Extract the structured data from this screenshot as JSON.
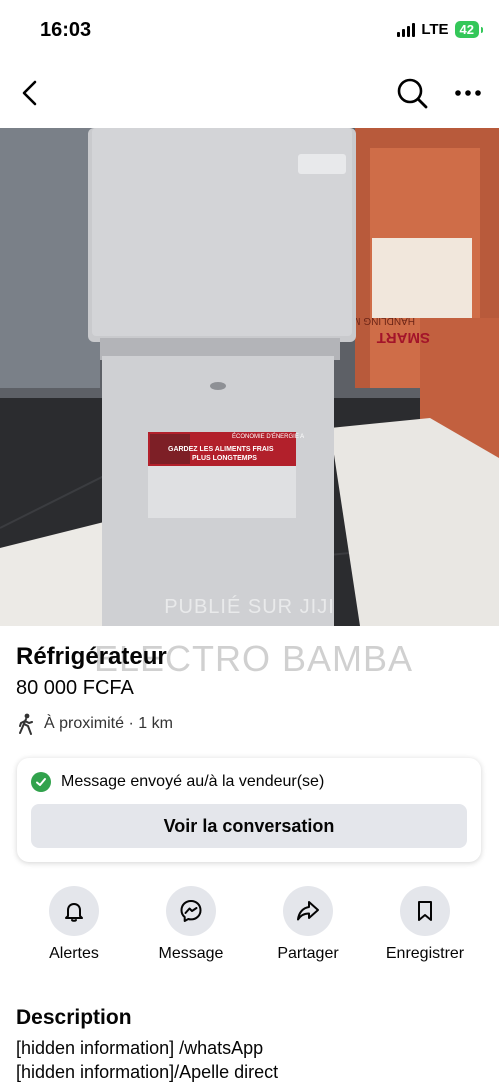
{
  "status_bar": {
    "time": "16:03",
    "network": "LTE",
    "battery": "42"
  },
  "listing": {
    "title": "Réfrigérateur",
    "price": "80 000 FCFA",
    "distance": "À proximité · 1 km",
    "photo": {
      "watermark": "PUBLIÉ SUR JIJI",
      "overlay_text": "ELECTRO BAMBA",
      "sticker_heading": "ÉCONOMIE D'ÉNERGIE A",
      "sticker_line1": "GARDEZ LES ALIMENTS FRAIS",
      "sticker_line2": "PLUS LONGTEMPS",
      "box_text1": "SMART",
      "box_text2": "HANDLING METHOD"
    }
  },
  "message_card": {
    "status": "Message envoyé au/à la vendeur(se)",
    "button": "Voir la conversation"
  },
  "actions": [
    {
      "label": "Alertes",
      "icon": "bell-icon"
    },
    {
      "label": "Message",
      "icon": "messenger-icon"
    },
    {
      "label": "Partager",
      "icon": "share-icon"
    },
    {
      "label": "Enregistrer",
      "icon": "bookmark-icon"
    }
  ],
  "description": {
    "title": "Description",
    "lines": [
      "[hidden information] /whatsApp",
      "[hidden information]/Apelle direct"
    ]
  },
  "colors": {
    "success": "#31a24c",
    "button_bg": "#e4e6eb",
    "battery": "#34c759"
  }
}
